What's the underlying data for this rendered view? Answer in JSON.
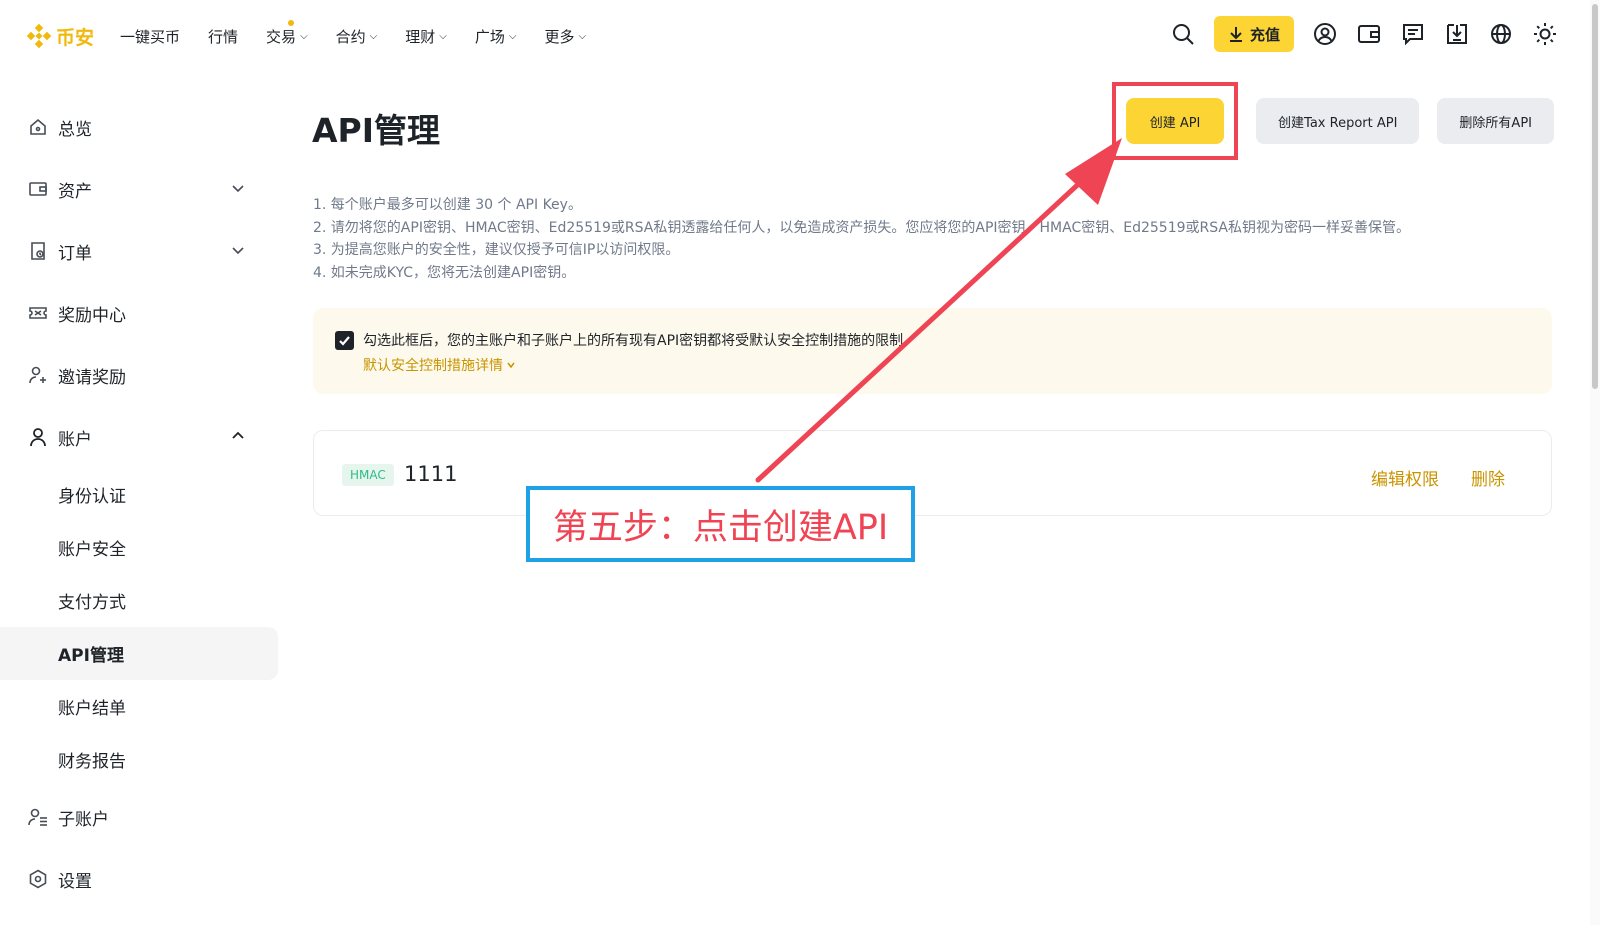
{
  "brand": {
    "logo_text": "币安",
    "accent": "#F0B90B"
  },
  "topnav": {
    "items": [
      {
        "label": "一键买币",
        "dropdown": false
      },
      {
        "label": "行情",
        "dropdown": false
      },
      {
        "label": "交易",
        "dropdown": true
      },
      {
        "label": "合约",
        "dropdown": true
      },
      {
        "label": "理财",
        "dropdown": true
      },
      {
        "label": "广场",
        "dropdown": true
      },
      {
        "label": "更多",
        "dropdown": true
      }
    ],
    "deposit_label": "充值",
    "icons": [
      "search-icon",
      "user-icon",
      "wallet-icon",
      "message-icon",
      "download-icon",
      "globe-icon",
      "sun-icon"
    ]
  },
  "sidebar": {
    "items": [
      {
        "label": "总览",
        "icon": "home-icon"
      },
      {
        "label": "资产",
        "icon": "wallet-icon"
      },
      {
        "label": "订单",
        "icon": "order-icon"
      },
      {
        "label": "奖励中心",
        "icon": "ticket-icon"
      },
      {
        "label": "邀请奖励",
        "icon": "user-plus-icon"
      },
      {
        "label": "账户",
        "icon": "user-icon"
      }
    ],
    "account_sub": [
      {
        "label": "身份认证"
      },
      {
        "label": "账户安全"
      },
      {
        "label": "支付方式"
      },
      {
        "label": "API管理",
        "active": true
      },
      {
        "label": "账户结单"
      },
      {
        "label": "财务报告"
      }
    ],
    "bottom_items": [
      {
        "label": "子账户",
        "icon": "sub-account-icon"
      },
      {
        "label": "设置",
        "icon": "settings-icon"
      }
    ]
  },
  "main": {
    "title": "API管理",
    "buttons": {
      "create": "创建 API",
      "create_tax": "创建Tax Report API",
      "delete_all": "删除所有API"
    },
    "notes": [
      "1. 每个账户最多可以创建 30 个 API Key。",
      "2. 请勿将您的API密钥、HMAC密钥、Ed25519或RSA私钥透露给任何人，以免造成资产损失。您应将您的API密钥、HMAC密钥、Ed25519或RSA私钥视为密码一样妥善保管。",
      "3. 为提高您账户的安全性，建议仅授予可信IP以访问权限。",
      "4. 如未完成KYC，您将无法创建API密钥。"
    ],
    "notice": {
      "checked": true,
      "text": "勾选此框后，您的主账户和子账户上的所有现有API密钥都将受默认安全控制措施的限制。",
      "link": "默认安全控制措施详情"
    },
    "api_keys": [
      {
        "type": "HMAC",
        "name": "1111",
        "edit_label": "编辑权限",
        "delete_label": "删除"
      }
    ]
  },
  "annotation": {
    "text": "第五步：点击创建API",
    "highlight_color": "#EF4453",
    "box_color": "#1EA1E6"
  }
}
